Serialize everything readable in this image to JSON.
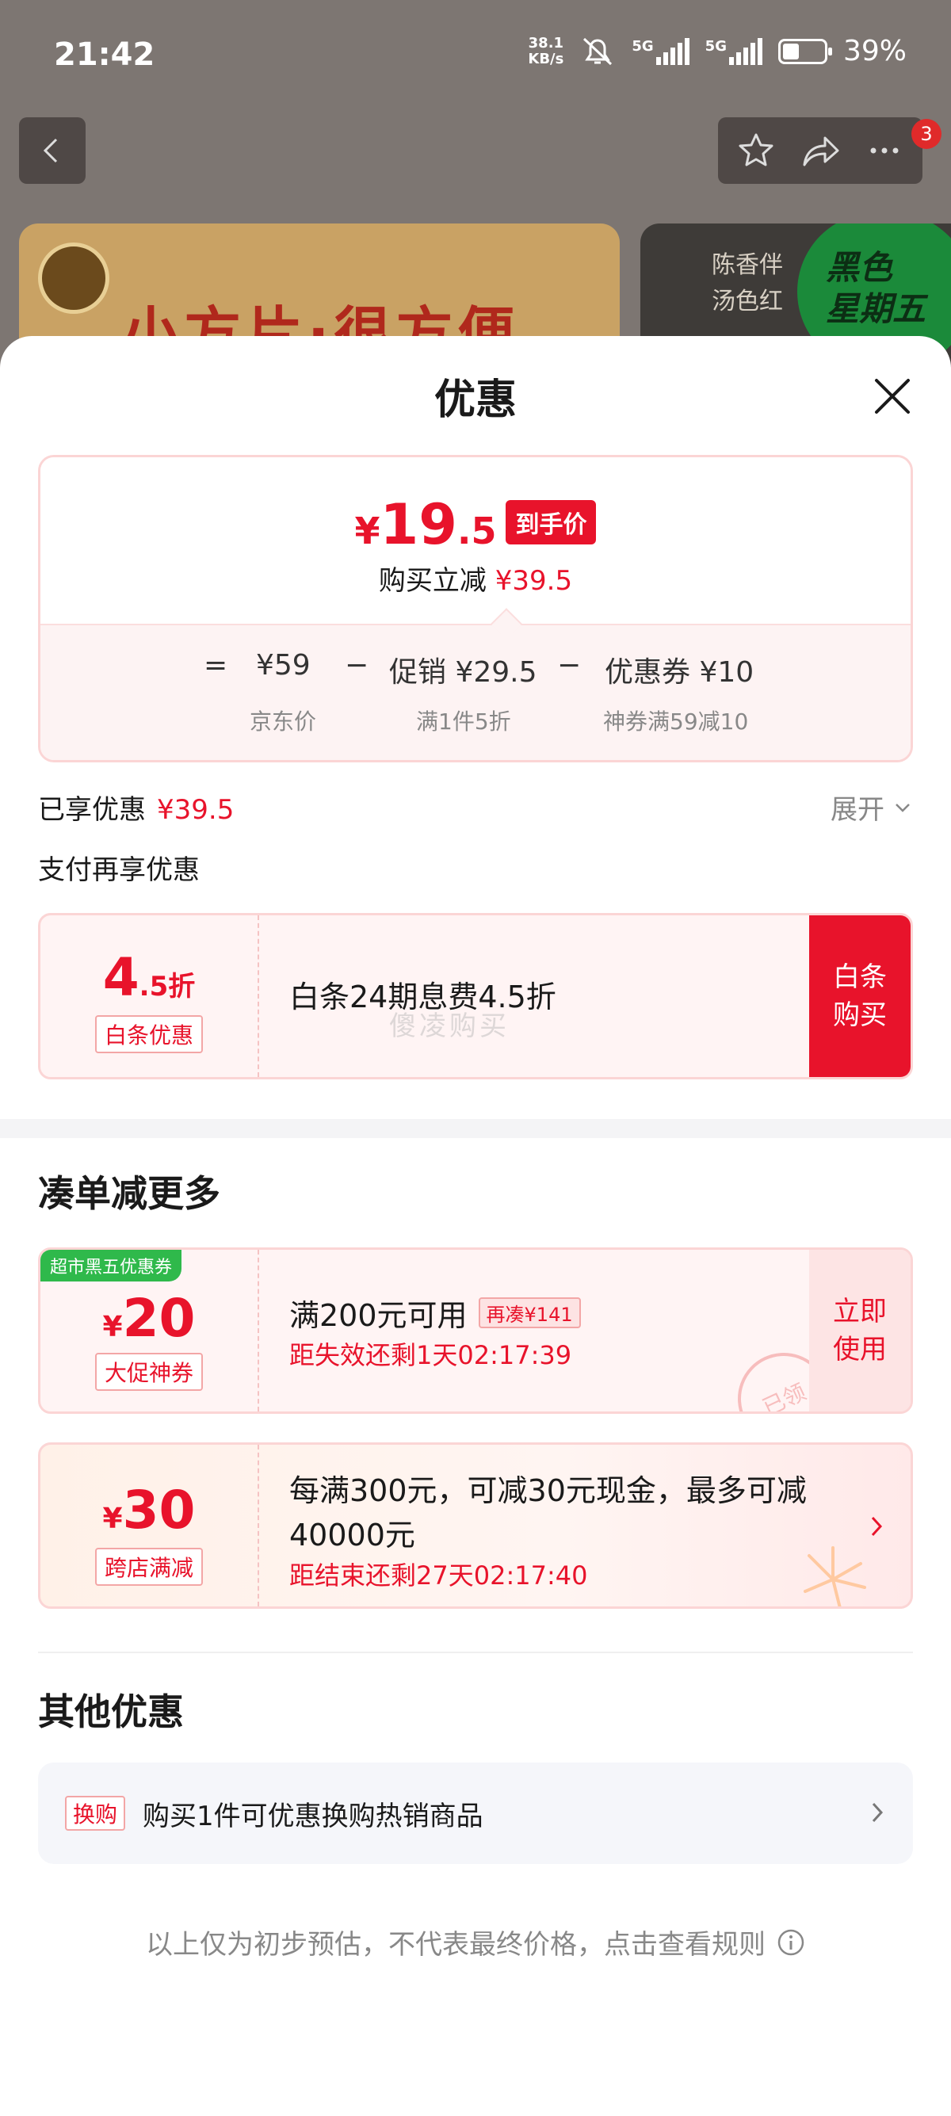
{
  "status_bar": {
    "time": "21:42",
    "net_speed_top": "38.1",
    "net_speed_bottom": "KB/s",
    "signal_1": "5G",
    "signal_2": "5G",
    "battery": "39%"
  },
  "nav": {
    "badge_count": "3",
    "icons": [
      "back-icon",
      "star-icon",
      "share-icon",
      "more-icon"
    ]
  },
  "background": {
    "banner_left_title": "小方片·很方便",
    "banner_right_lines": [
      "陈香伴",
      "汤色红"
    ],
    "banner_right_badge": [
      "黑色",
      "星期五"
    ]
  },
  "sheet": {
    "title": "优惠",
    "price": {
      "currency": "¥",
      "integer": "19",
      "decimal": ".5",
      "tag": "到手价",
      "instant_label": "购买立减",
      "instant_amount": "¥39.5"
    },
    "formula": {
      "equals": "=",
      "base_price": "¥59",
      "base_label": "京东价",
      "minus1": "−",
      "promo_price": "促销 ¥29.5",
      "promo_label": "满1件5折",
      "minus2": "−",
      "coupon_price": "优惠券 ¥10",
      "coupon_label": "神券满59减10"
    },
    "enjoyed": {
      "label": "已享优惠",
      "amount": "¥39.5",
      "expand": "展开"
    },
    "pay_title": "支付再享优惠",
    "baitiao": {
      "rate_big": "4",
      "rate_small": ".5折",
      "tag": "白条优惠",
      "text": "白条24期息费4.5折",
      "watermark": "傻凌购买",
      "button_line1": "白条",
      "button_line2": "购买"
    },
    "more_title": "凑单减更多",
    "coupon1": {
      "corner": "超市黑五优惠券",
      "currency": "¥",
      "amount": "20",
      "tag": "大促神券",
      "title": "满200元可用",
      "add_tag": "再凑¥141",
      "timer": "距失效还剩1天02:17:39",
      "button_line1": "立即",
      "button_line2": "使用",
      "stamp": "已领"
    },
    "coupon2": {
      "currency": "¥",
      "amount": "30",
      "tag": "跨店满减",
      "title": "每满300元，可减30元现金，最多可减40000元",
      "timer": "距结束还剩27天02:17:40"
    },
    "other_title": "其他优惠",
    "other": {
      "tag": "换购",
      "text": "购买1件可优惠换购热销商品"
    },
    "footnote": "以上仅为初步预估，不代表最终价格，点击查看规则"
  },
  "colors": {
    "accent_red": "#e8132b",
    "coupon_green": "#2fb94b",
    "light_pink": "#fff4f4"
  }
}
